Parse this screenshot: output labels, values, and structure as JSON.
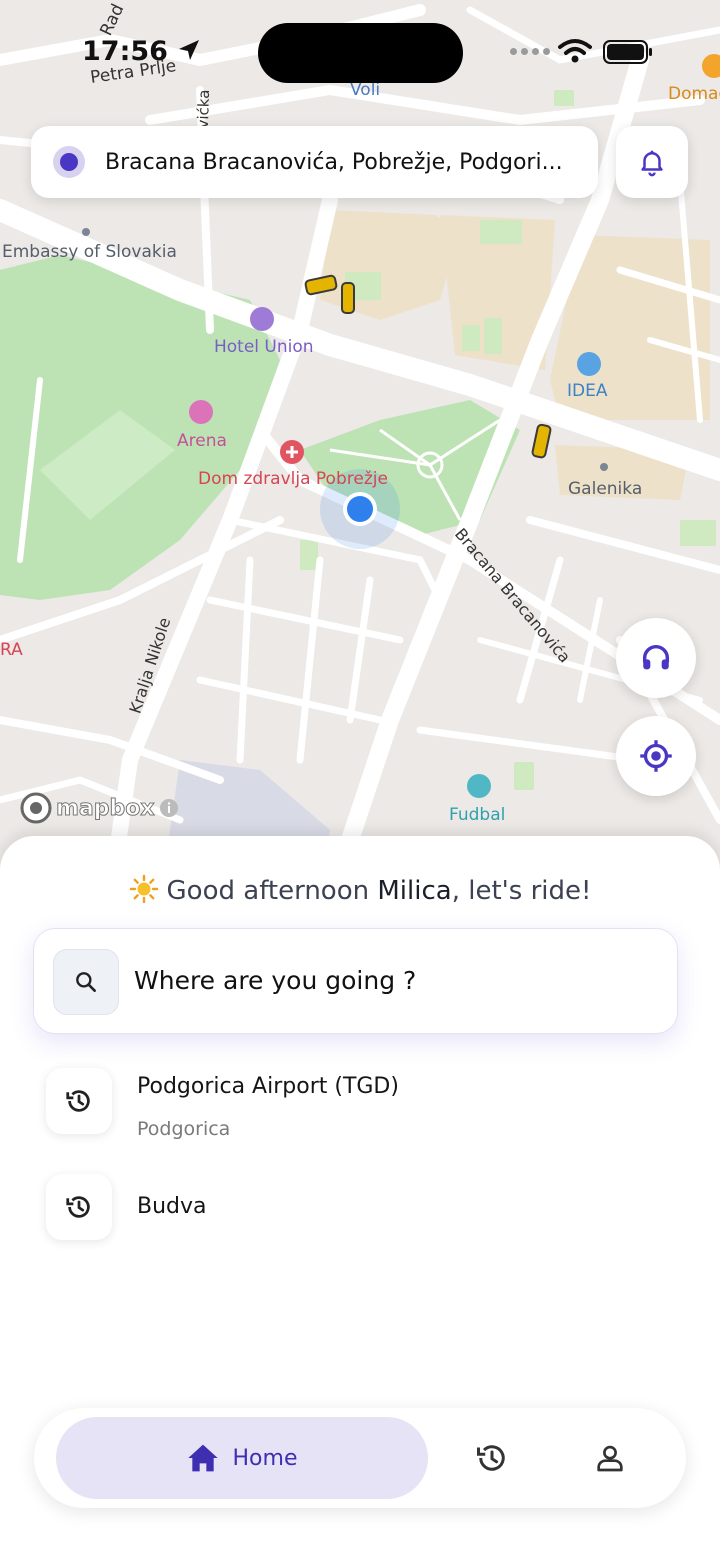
{
  "status_bar": {
    "time": "17:56"
  },
  "location_bar": {
    "address": "Bracana Bracanovića, Pobrežje, Podgori..."
  },
  "map": {
    "attribution": "mapbox",
    "labels": {
      "voli": "Voli",
      "domac": "Domac",
      "petra_prlje": "Petra Prlje",
      "rad": "Rad",
      "vicka": "vićka",
      "embassy": "Embassy of Slovakia",
      "hotel_union": "Hotel Union",
      "idea": "IDEA",
      "arena": "Arena",
      "dom_zdravlja": "Dom zdravlja Pobrežje",
      "galenika": "Galenika",
      "street_bracana": "Bracana Bracanovića",
      "street_kralja": "Kralja Nikole",
      "ra": "RA",
      "fudbal": "Fudbal"
    }
  },
  "sheet": {
    "greeting_prefix": "Good afternoon ",
    "user_name": "Milica",
    "greeting_suffix": ", let's ride!",
    "search_placeholder": "Where are you going ?",
    "recent": [
      {
        "title": "Podgorica Airport (TGD)",
        "subtitle": "Podgorica"
      },
      {
        "title": "Budva"
      }
    ]
  },
  "nav": {
    "home_label": "Home"
  },
  "colors": {
    "accent": "#4a36c4",
    "accent_light": "#e7e3f6",
    "location_blue": "#2f80ed"
  }
}
